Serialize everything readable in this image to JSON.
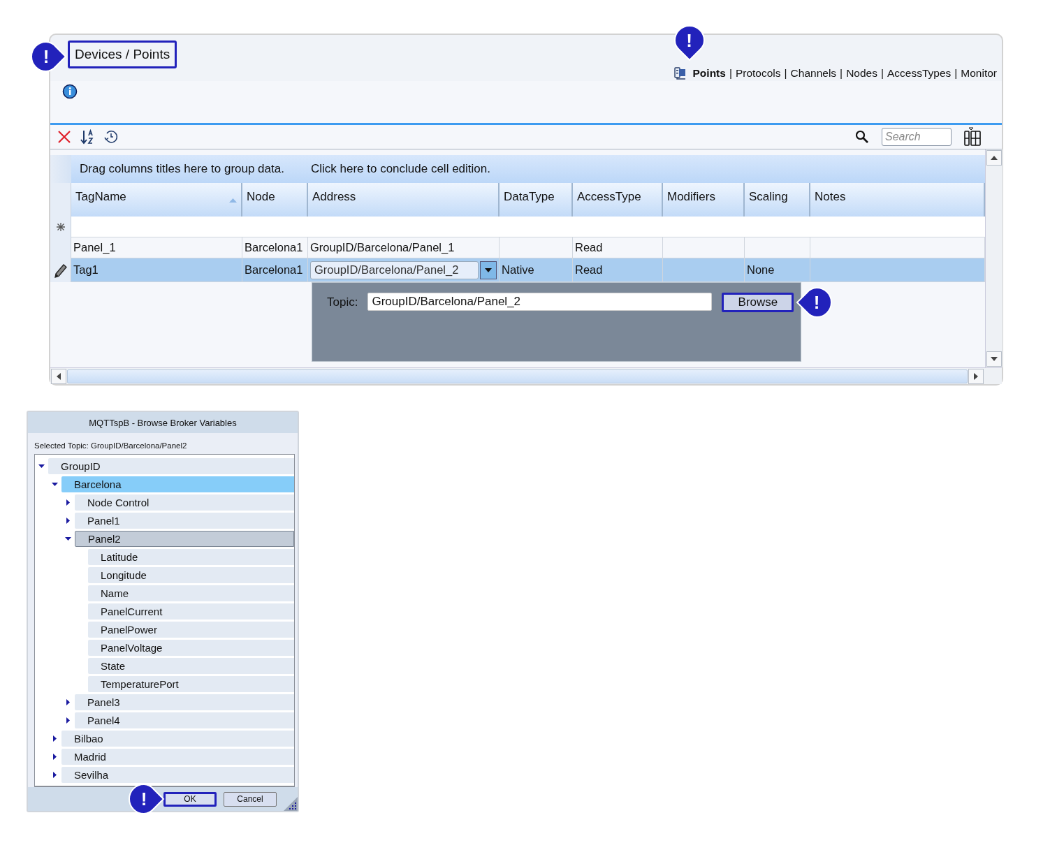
{
  "main": {
    "breadcrumb": {
      "text": "Devices / Points",
      "highlighted": true
    },
    "breadcrumb_callout": {
      "text": "!"
    },
    "nav": {
      "separator": "|",
      "items": [
        {
          "label": "Points",
          "selected": true
        },
        {
          "label": "Protocols",
          "selected": false
        },
        {
          "label": "Channels",
          "selected": false
        },
        {
          "label": "Nodes",
          "selected": false
        },
        {
          "label": "AccessTypes",
          "selected": false
        },
        {
          "label": "Monitor",
          "selected": false
        }
      ]
    },
    "nav_callout": {
      "text": "!"
    },
    "toolbar": {
      "search_placeholder": "Search"
    },
    "grid": {
      "group_hint": "Drag columns titles here to group data.",
      "conclude_hint": "Click here to conclude cell edition.",
      "columns": [
        {
          "label": "TagName",
          "sorted": true
        },
        {
          "label": "Node",
          "sorted": false
        },
        {
          "label": "Address",
          "sorted": false
        },
        {
          "label": "DataType",
          "sorted": false
        },
        {
          "label": "AccessType",
          "sorted": false
        },
        {
          "label": "Modifiers",
          "sorted": false
        },
        {
          "label": "Scaling",
          "sorted": false
        },
        {
          "label": "Notes",
          "sorted": false
        }
      ],
      "rows": [
        {
          "selected": false,
          "editing": false,
          "cells": [
            "Panel_1",
            "Barcelona1",
            "GroupID/Barcelona/Panel_1",
            null,
            "Read",
            null,
            null,
            null
          ]
        },
        {
          "selected": true,
          "editing": true,
          "cells": [
            "Tag1",
            "Barcelona1",
            {
              "kind": "combo",
              "value": "GroupID/Barcelona/Panel_2"
            },
            "Native",
            "Read",
            null,
            "None",
            null
          ]
        }
      ]
    },
    "editor": {
      "label": "Topic:",
      "value": "GroupID/Barcelona/Panel_2",
      "button": {
        "label": "Browse",
        "highlighted": true
      },
      "callout": {
        "text": "!"
      }
    }
  },
  "dialog": {
    "title": "MQTTspB - Browse Broker Variables",
    "selected_topic": "Selected Topic: GroupID/Barcelona/Panel2",
    "tree": [
      {
        "label": "GroupID",
        "expanded": true,
        "selected": false,
        "focused": false,
        "children": [
          {
            "label": "Barcelona",
            "expanded": true,
            "selected": true,
            "focused": false,
            "children": [
              {
                "label": "Node Control",
                "expanded": false,
                "selected": false,
                "focused": false
              },
              {
                "label": "Panel1",
                "expanded": false,
                "selected": false,
                "focused": false
              },
              {
                "label": "Panel2",
                "expanded": true,
                "selected": false,
                "focused": true,
                "children": [
                  {
                    "label": "Latitude",
                    "selected": false,
                    "focused": false
                  },
                  {
                    "label": "Longitude",
                    "selected": false,
                    "focused": false
                  },
                  {
                    "label": "Name",
                    "selected": false,
                    "focused": false
                  },
                  {
                    "label": "PanelCurrent",
                    "selected": false,
                    "focused": false
                  },
                  {
                    "label": "PanelPower",
                    "selected": false,
                    "focused": false
                  },
                  {
                    "label": "PanelVoltage",
                    "selected": false,
                    "focused": false
                  },
                  {
                    "label": "State",
                    "selected": false,
                    "focused": false
                  },
                  {
                    "label": "TemperaturePort",
                    "selected": false,
                    "focused": false
                  }
                ]
              },
              {
                "label": "Panel3",
                "expanded": false,
                "selected": false,
                "focused": false
              },
              {
                "label": "Panel4",
                "expanded": false,
                "selected": false,
                "focused": false
              }
            ]
          },
          {
            "label": "Bilbao",
            "expanded": false,
            "selected": false,
            "focused": false
          },
          {
            "label": "Madrid",
            "expanded": false,
            "selected": false,
            "focused": false
          },
          {
            "label": "Sevilha",
            "expanded": false,
            "selected": false,
            "focused": false
          }
        ]
      }
    ],
    "buttons": [
      {
        "label": "OK",
        "highlighted": true
      },
      {
        "label": "Cancel",
        "highlighted": false
      }
    ],
    "ok_callout": {
      "text": "!"
    }
  }
}
